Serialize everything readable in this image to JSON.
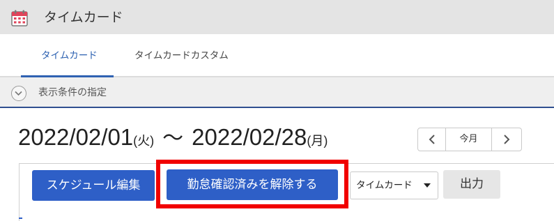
{
  "app": {
    "icon": "calendar-icon",
    "title": "タイムカード"
  },
  "tabs": [
    {
      "label": "タイムカード",
      "active": true
    },
    {
      "label": "タイムカードカスタム",
      "active": false
    }
  ],
  "filter": {
    "toggle_icon": "chevron-down-circle-icon",
    "label": "表示条件の指定"
  },
  "date_range": {
    "start_date": "2022/02/01",
    "start_weekday": "(火)",
    "separator": "〜",
    "end_date": "2022/02/28",
    "end_weekday": "(月)"
  },
  "pager": {
    "prev_icon": "chevron-left-icon",
    "today_label": "今月",
    "next_icon": "chevron-right-icon"
  },
  "toolbar": {
    "schedule_edit_label": "スケジュール編集",
    "unlock_confirmed_label": "勤怠確認済みを解除する",
    "view_select_value": "タイムカード",
    "output_label": "出力"
  },
  "colors": {
    "primary_button": "#2e5fc7",
    "active_tab": "#2a5fb0",
    "highlight": "#f10000",
    "header_bg": "#e4e4e4"
  }
}
